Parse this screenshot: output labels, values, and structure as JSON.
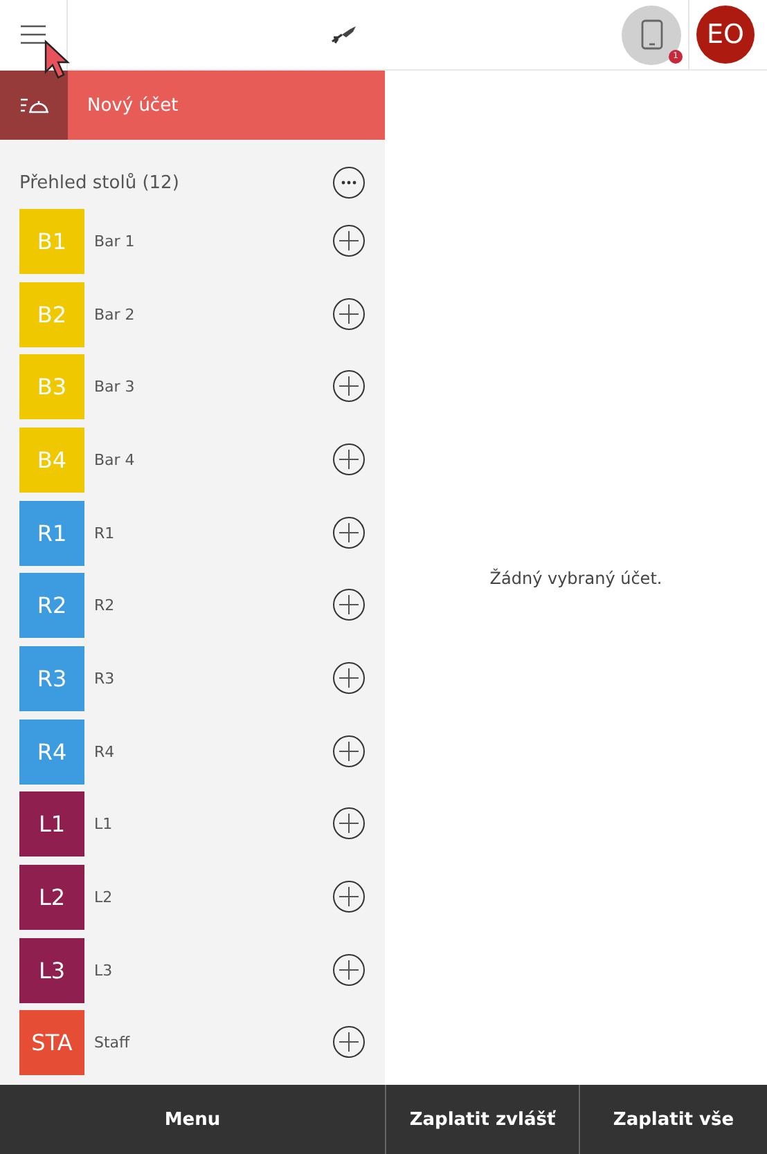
{
  "header": {
    "notification_badge": "1",
    "avatar": "EO"
  },
  "new_account": {
    "label": "Nový účet"
  },
  "tables_panel": {
    "title": "Přehled stolů (12)",
    "tables": [
      {
        "code": "B1",
        "name": "Bar 1",
        "color": "#f0c800"
      },
      {
        "code": "B2",
        "name": "Bar 2",
        "color": "#f0c800"
      },
      {
        "code": "B3",
        "name": "Bar 3",
        "color": "#f0c800"
      },
      {
        "code": "B4",
        "name": "Bar 4",
        "color": "#f0c800"
      },
      {
        "code": "R1",
        "name": "R1",
        "color": "#3d9be0"
      },
      {
        "code": "R2",
        "name": "R2",
        "color": "#3d9be0"
      },
      {
        "code": "R3",
        "name": "R3",
        "color": "#3d9be0"
      },
      {
        "code": "R4",
        "name": "R4",
        "color": "#3d9be0"
      },
      {
        "code": "L1",
        "name": "L1",
        "color": "#8e1f4e"
      },
      {
        "code": "L2",
        "name": "L2",
        "color": "#8e1f4e"
      },
      {
        "code": "L3",
        "name": "L3",
        "color": "#8e1f4e"
      },
      {
        "code": "STA",
        "name": "Staff",
        "color": "#e54d35"
      }
    ]
  },
  "detail": {
    "empty_message": "Žádný vybraný účet."
  },
  "bottom_bar": [
    "Menu",
    "Zaplatit zvlášť",
    "Zaplatit vše"
  ]
}
